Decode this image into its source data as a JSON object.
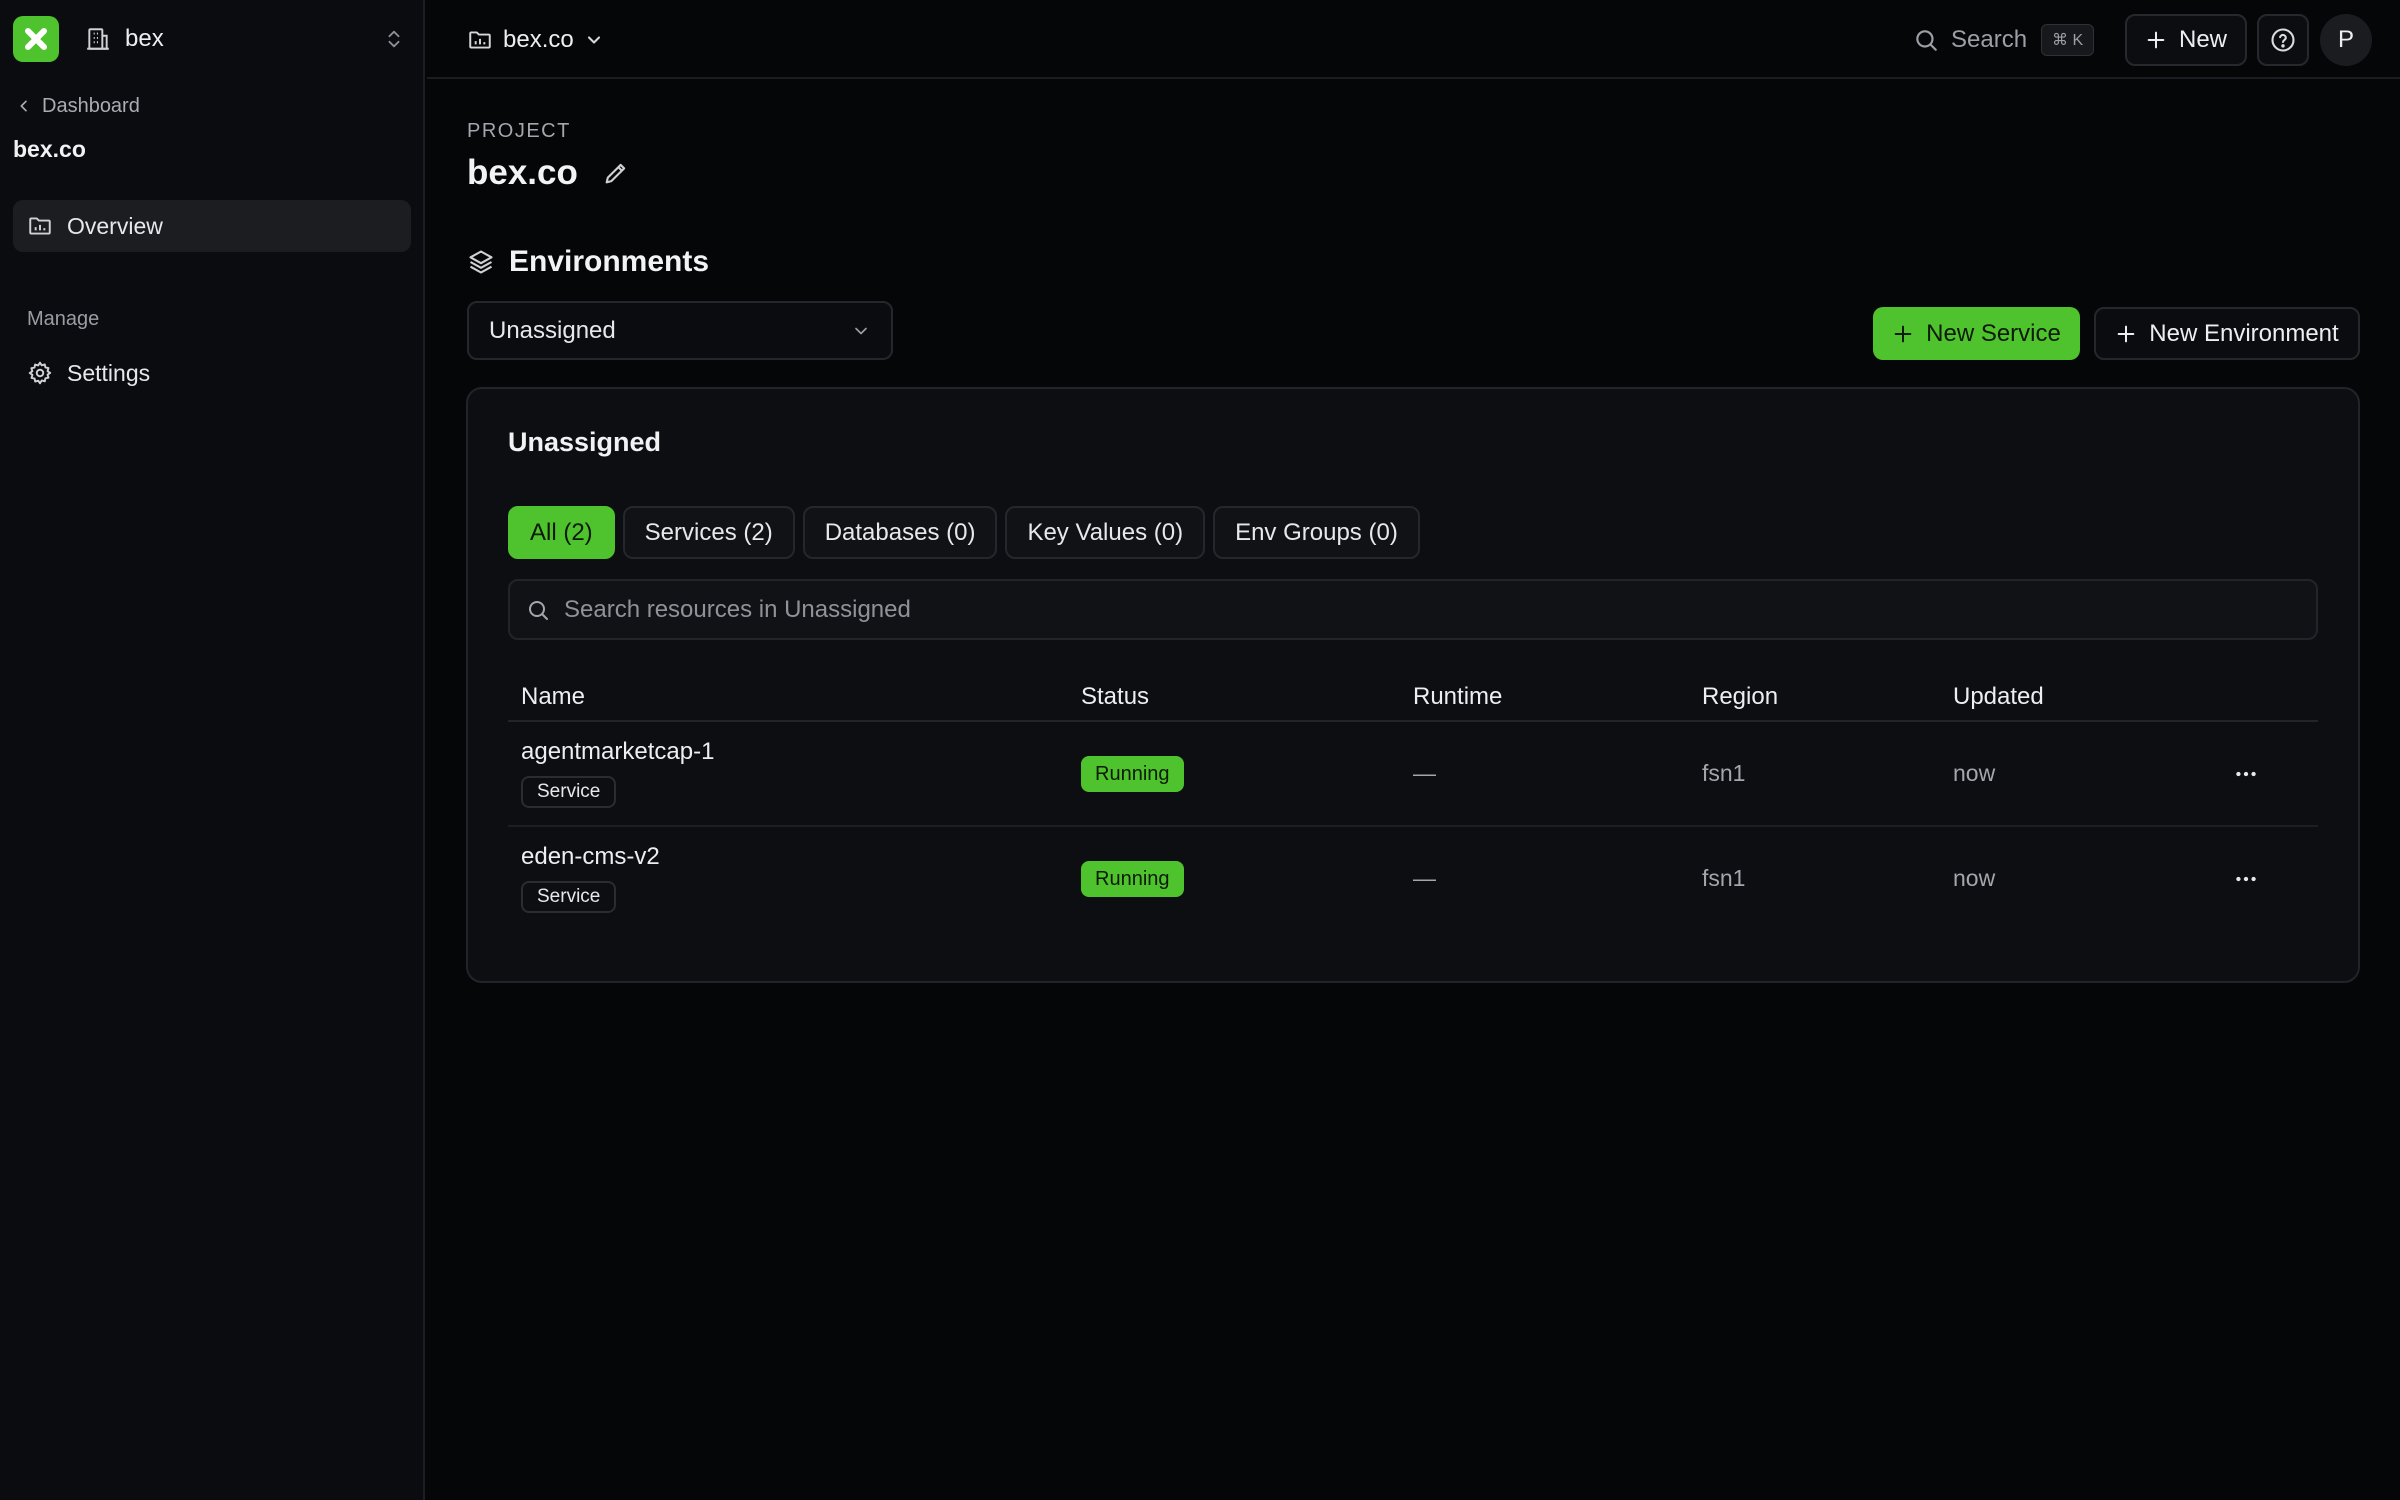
{
  "sidebar": {
    "workspace_name": "bex",
    "back_label": "Dashboard",
    "project_name": "bex.co",
    "nav_overview": "Overview",
    "section_manage": "Manage",
    "nav_settings": "Settings"
  },
  "topbar": {
    "breadcrumb_project": "bex.co",
    "search_label": "Search",
    "search_shortcut": "⌘ K",
    "new_label": "New",
    "avatar_initial": "P"
  },
  "main": {
    "eyebrow": "PROJECT",
    "title": "bex.co",
    "environments_heading": "Environments",
    "environment_select_value": "Unassigned",
    "new_service_label": "New Service",
    "new_environment_label": "New Environment"
  },
  "card": {
    "title": "Unassigned",
    "tabs": [
      {
        "label": "All (2)",
        "active": true
      },
      {
        "label": "Services (2)",
        "active": false
      },
      {
        "label": "Databases (0)",
        "active": false
      },
      {
        "label": "Key Values (0)",
        "active": false
      },
      {
        "label": "Env Groups (0)",
        "active": false
      }
    ],
    "search_placeholder": "Search resources in Unassigned",
    "columns": {
      "name": "Name",
      "status": "Status",
      "runtime": "Runtime",
      "region": "Region",
      "updated": "Updated"
    },
    "rows": [
      {
        "name": "agentmarketcap-1",
        "type": "Service",
        "status": "Running",
        "runtime": "—",
        "region": "fsn1",
        "updated": "now"
      },
      {
        "name": "eden-cms-v2",
        "type": "Service",
        "status": "Running",
        "runtime": "—",
        "region": "fsn1",
        "updated": "now"
      }
    ]
  },
  "colors": {
    "accent": "#4fc32d",
    "background": "#050608",
    "sidebar": "#0b0c0f",
    "card": "#0d0e11"
  },
  "icons": {
    "logo": "brand-x-icon",
    "workspace": "building-icon",
    "project": "folder-chart-icon",
    "settings": "gear-icon",
    "environments": "layers-icon",
    "edit": "pencil-icon",
    "search": "search-icon",
    "help": "help-circle-icon",
    "more": "ellipsis-icon"
  }
}
